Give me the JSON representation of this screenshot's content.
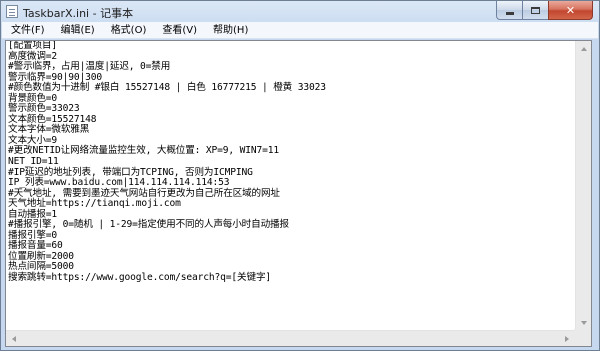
{
  "window": {
    "title": "TaskbarX.ini - 记事本",
    "minimize_icon": "minimize-icon",
    "maximize_icon": "maximize-icon",
    "close_label": "✕"
  },
  "menubar": {
    "items": [
      {
        "label": "文件(F)"
      },
      {
        "label": "编辑(E)"
      },
      {
        "label": "格式(O)"
      },
      {
        "label": "查看(V)"
      },
      {
        "label": "帮助(H)"
      }
    ]
  },
  "editor": {
    "lines": [
      "[配置项目]",
      "高度微调=2",
      "#警示临界，占用|温度|延迟, 0=禁用",
      "警示临界=90|90|300",
      "#颜色数值为十进制 #银白 15527148 | 白色 16777215 | 橙黄 33023",
      "背景颜色=0",
      "警示颜色=33023",
      "文本颜色=15527148",
      "文本字体=微软雅黑",
      "文本大小=9",
      "#更改NETID让网络流量监控生效, 大概位置: XP=9, WIN7=11",
      "NET_ID=11",
      "#IP延迟的地址列表, 带端口为TCPING, 否则为ICMPING",
      "IP_列表=www.baidu.com|114.114.114.114:53",
      "#天气地址, 需要到墨迹天气网站自行更改为自己所在区域的网址",
      "天气地址=https://tianqi.moji.com",
      "自动播报=1",
      "#播报引擎, 0=随机 | 1-29=指定使用不同的人声每小时自动播报",
      "播报引擎=0",
      "播报音量=60",
      "位置刷新=2000",
      "热点间隔=5000",
      "搜索跳转=https://www.google.com/search?q=[关键字]"
    ]
  }
}
